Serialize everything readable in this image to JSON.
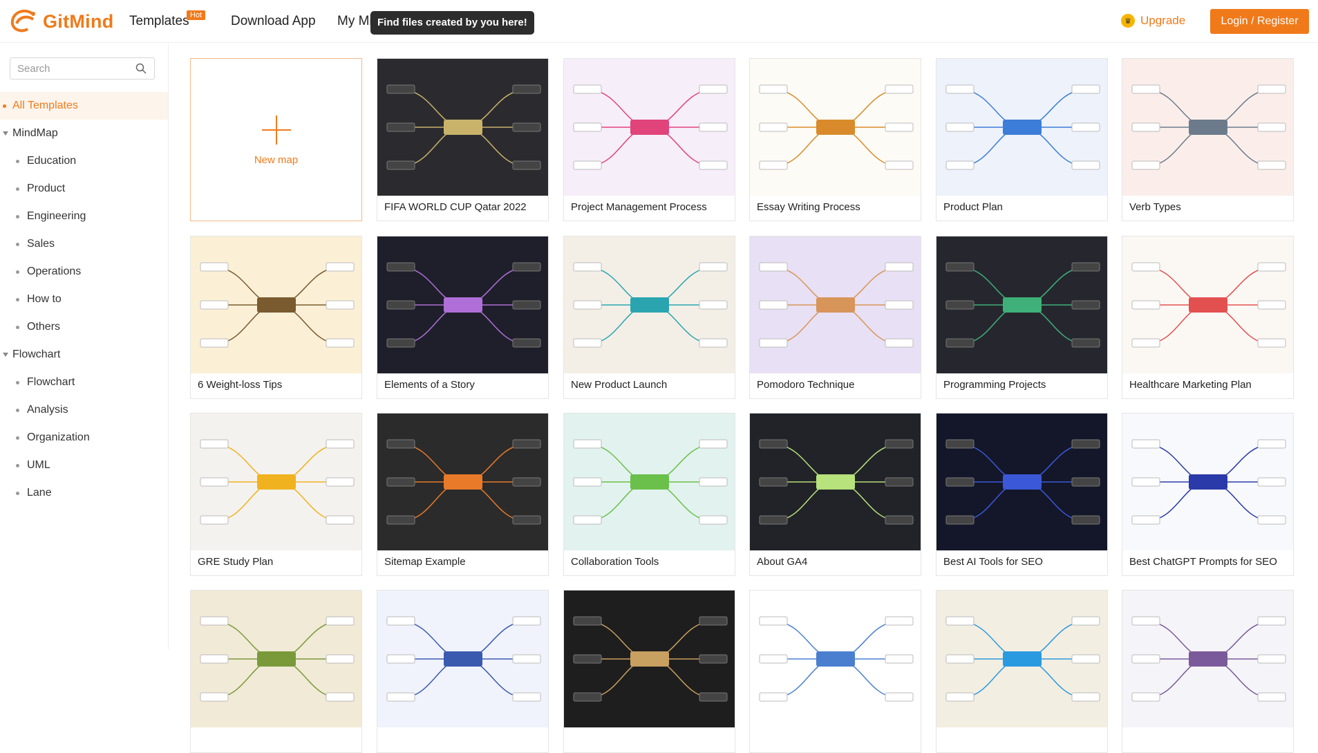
{
  "header": {
    "logo_text": "GitMind",
    "nav": [
      {
        "label": "Templates"
      },
      {
        "label": "Download App"
      },
      {
        "label": "My Mi"
      }
    ],
    "hot_badge": "Hot",
    "tooltip": "Find files created by you here!",
    "upgrade_label": "Upgrade",
    "login_label": "Login / Register"
  },
  "sidebar": {
    "search_placeholder": "Search",
    "items": [
      {
        "label": "All Templates",
        "level": 0,
        "active": true
      },
      {
        "label": "MindMap",
        "level": 0,
        "expanded": true
      },
      {
        "label": "Education",
        "level": 1
      },
      {
        "label": "Product",
        "level": 1
      },
      {
        "label": "Engineering",
        "level": 1
      },
      {
        "label": "Sales",
        "level": 1
      },
      {
        "label": "Operations",
        "level": 1
      },
      {
        "label": "How to",
        "level": 1
      },
      {
        "label": "Others",
        "level": 1
      },
      {
        "label": "Flowchart",
        "level": 0,
        "expanded": true
      },
      {
        "label": "Flowchart",
        "level": 1
      },
      {
        "label": "Analysis",
        "level": 1
      },
      {
        "label": "Organization",
        "level": 1
      },
      {
        "label": "UML",
        "level": 1
      },
      {
        "label": "Lane",
        "level": 1
      }
    ]
  },
  "new_map_label": "New map",
  "templates": [
    {
      "title": "FIFA WORLD CUP Qatar 2022",
      "bg": "#2b2b2f",
      "accent": "#c9b26a"
    },
    {
      "title": "Project Management Process",
      "bg": "#f6eef8",
      "accent": "#e0447a"
    },
    {
      "title": "Essay Writing Process",
      "bg": "#fdfbf5",
      "accent": "#d98b2b"
    },
    {
      "title": "Product Plan",
      "bg": "#eef2fb",
      "accent": "#3b7dd8"
    },
    {
      "title": "Verb Types",
      "bg": "#fbeeea",
      "accent": "#6b7b8c"
    },
    {
      "title": "6 Weight-loss Tips",
      "bg": "#fbf0d6",
      "accent": "#7a5a2f"
    },
    {
      "title": "Elements of a Story",
      "bg": "#1e1f2a",
      "accent": "#b06fd8"
    },
    {
      "title": "New Product Launch",
      "bg": "#f3efe6",
      "accent": "#2aa5b0"
    },
    {
      "title": "Pomodoro Technique",
      "bg": "#e8e0f4",
      "accent": "#d8955a"
    },
    {
      "title": "Programming Projects",
      "bg": "#26272e",
      "accent": "#3fb07a"
    },
    {
      "title": "Healthcare Marketing Plan",
      "bg": "#fbf8f4",
      "accent": "#e35050"
    },
    {
      "title": "GRE Study Plan",
      "bg": "#f4f2ee",
      "accent": "#f0b21e"
    },
    {
      "title": "Sitemap Example",
      "bg": "#2b2b2b",
      "accent": "#e87a2a"
    },
    {
      "title": "Collaboration Tools",
      "bg": "#e2f2ef",
      "accent": "#6ac04a"
    },
    {
      "title": "About GA4",
      "bg": "#222328",
      "accent": "#b7e27c"
    },
    {
      "title": "Best AI Tools for SEO",
      "bg": "#141729",
      "accent": "#3a58d8"
    },
    {
      "title": "Best ChatGPT Prompts for SEO",
      "bg": "#f8f9fc",
      "accent": "#2a3aa8"
    },
    {
      "title": "",
      "bg": "#f1ead6",
      "accent": "#7a9a3a"
    },
    {
      "title": "",
      "bg": "#f0f3fb",
      "accent": "#3a5ab0"
    },
    {
      "title": "",
      "bg": "#1e1e1e",
      "accent": "#c8a060"
    },
    {
      "title": "",
      "bg": "#ffffff",
      "accent": "#4a7fd0"
    },
    {
      "title": "",
      "bg": "#f3eee2",
      "accent": "#2a9ae0"
    },
    {
      "title": "",
      "bg": "#f5f4f8",
      "accent": "#7a5a9a"
    }
  ]
}
